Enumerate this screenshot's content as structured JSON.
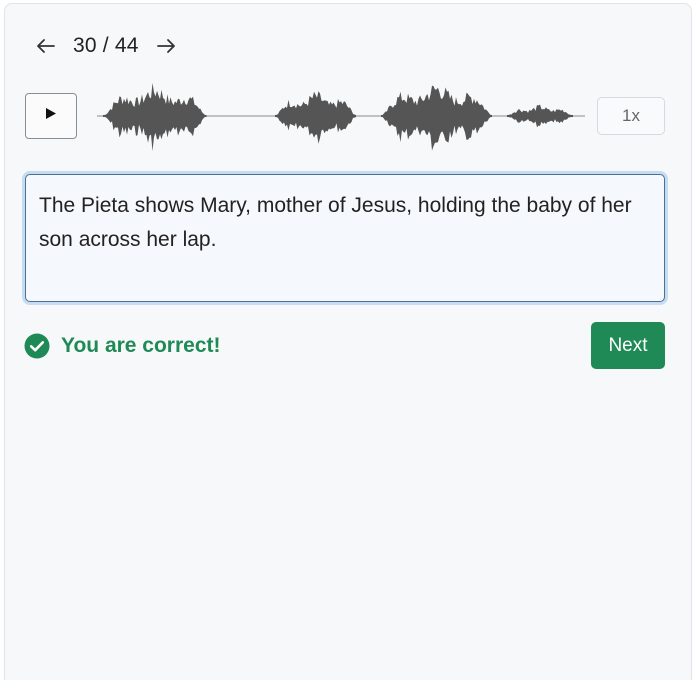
{
  "pager": {
    "current": "30",
    "separator": "/",
    "total": "44",
    "label": "30 / 44",
    "prev_icon": "arrow-left-icon",
    "next_icon": "arrow-right-icon"
  },
  "player": {
    "play_icon": "play-icon",
    "speed_label": "1x",
    "waveform_color": "#555555"
  },
  "answer": {
    "text": "The Pieta shows Mary, mother of Jesus, holding the baby of her son across her lap."
  },
  "feedback": {
    "icon": "check-circle-icon",
    "message": "You are correct!",
    "color": "#1f8a55"
  },
  "actions": {
    "next_label": "Next",
    "next_color": "#1f8a55"
  }
}
